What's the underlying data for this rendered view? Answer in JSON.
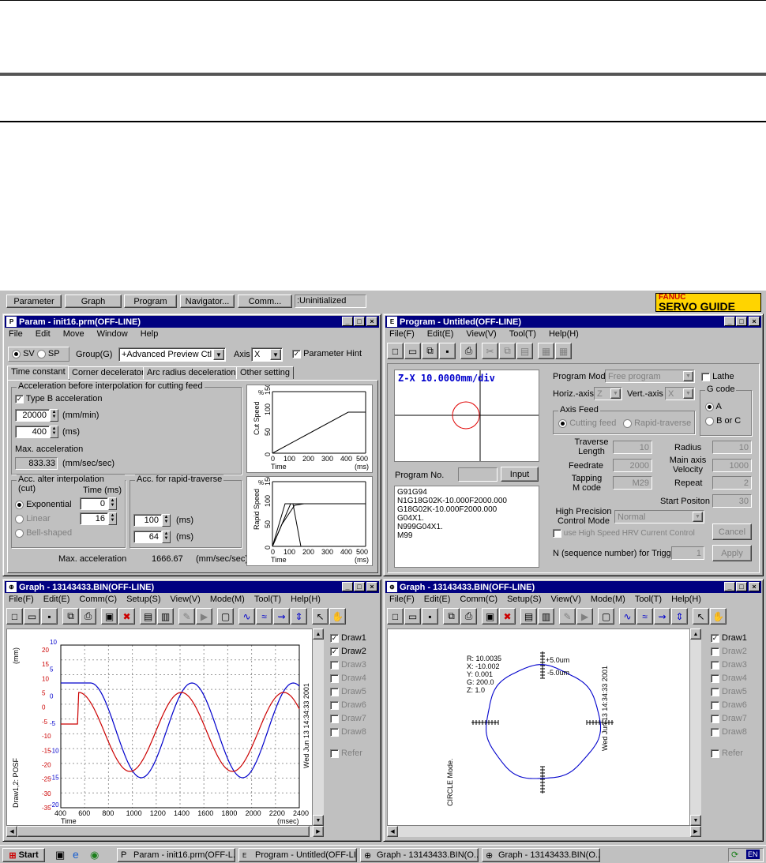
{
  "doc_rules": {
    "top_rule_note": ""
  },
  "top_bar": {
    "buttons": [
      "Parameter",
      "Graph",
      "Program",
      "Navigator...",
      "Comm..."
    ],
    "status": ":Uninitialized",
    "logo_line1": "FANUC",
    "logo_line2": "SERVO GUIDE"
  },
  "param": {
    "title": "Param - init16.prm(OFF-LINE)",
    "menu": [
      "File",
      "Edit",
      "Move",
      "Window",
      "Help"
    ],
    "sv": "SV",
    "sp": "SP",
    "group_label": "Group(G)",
    "group_value": "+Advanced Preview Ctl",
    "axis_label": "Axis",
    "axis_value": "X",
    "hint_label": "Parameter Hint",
    "tabs": [
      "Time constant",
      "Corner deceleraton",
      "Arc radius deceleration",
      "Other setting"
    ],
    "acc_group": "Acceleration before interpolation for cutting feed",
    "typeb": "Type B acceleration",
    "val1": "20000",
    "unit1": "(mm/min)",
    "val2": "400",
    "unit2": "(ms)",
    "maxacc_label": "Max. acceleration",
    "maxacc_val": "833.33",
    "maxacc_unit": "(mm/sec/sec)",
    "acc_after": "Acc. alter interpolation (cut)",
    "time_ms": "Time (ms)",
    "exp": "Exponential",
    "exp_val": "0",
    "linear": "Linear",
    "linear_val": "16",
    "bell": "Bell-shaped",
    "rapid_group": "Acc. for rapid-traverse",
    "rapid_val1": "100",
    "rapid_unit1": "(ms)",
    "rapid_val2": "64",
    "rapid_unit2": "(ms)",
    "max2_label": "Max. acceleration",
    "max2_val": "1666.67",
    "max2_unit": "(mm/sec/sec)",
    "chart1": {
      "ylabel": "Cut Speed",
      "yunit": "%",
      "yticks": [
        "0",
        "50",
        "100",
        "150"
      ],
      "xticks": [
        "0",
        "100",
        "200",
        "300",
        "400",
        "500"
      ],
      "xlabel": "Time",
      "xunit": "(ms)"
    },
    "chart2": {
      "ylabel": "Rapid Speed",
      "yunit": "%",
      "yticks": [
        "0",
        "50",
        "100",
        "150"
      ],
      "xticks": [
        "0",
        "100",
        "200",
        "300",
        "400",
        "500"
      ],
      "xlabel": "Time",
      "xunit": "(ms)"
    }
  },
  "program": {
    "title": "Program - Untitled(OFF-LINE)",
    "menu": [
      "File(F)",
      "Edit(E)",
      "View(V)",
      "Tool(T)",
      "Help(H)"
    ],
    "plot_label": "Z-X 10.0000mm/div",
    "mode_label": "Program Mode",
    "mode_value": "Free program",
    "lathe": "Lathe",
    "horiz_label": "Horiz.-axis",
    "horiz_value": "Z",
    "vert_label": "Vert.-axis",
    "vert_value": "X",
    "gcode_label": "G code",
    "gcode_a": "A",
    "gcode_bc": "B or C",
    "feed_group": "Axis Feed",
    "cutting": "Cutting feed",
    "rapid": "Rapid-traverse",
    "trav_label": "Traverse Length",
    "trav_val": "10",
    "radius_label": "Radius",
    "radius_val": "10",
    "feed_label": "Feedrate",
    "feed_val": "2000",
    "main_label": "Main axis Velocity",
    "main_val": "1000",
    "tap_label": "Tapping M code",
    "tap_val": "M29",
    "repeat_label": "Repeat",
    "repeat_val": "2",
    "start_label": "Start Positon",
    "start_val": "30",
    "progno_label": "Program No.",
    "input_btn": "Input",
    "code": [
      "G91G94",
      "N1G18G02K-10.000F2000.000",
      "G18G02K-10.000F2000.000",
      "G04X1.",
      "N999G04X1.",
      "M99"
    ],
    "hp_label": "High Precision Control Mode",
    "hp_value": "Normal",
    "cancel": "Cancel",
    "hrv": "use High Speed HRV Current Control",
    "trigger_label": "N (sequence number) for Trigger",
    "trigger_val": "1",
    "apply": "Apply"
  },
  "graph1": {
    "title": "Graph - 13143433.BIN(OFF-LINE)",
    "menu": [
      "File(F)",
      "Edit(E)",
      "Comm(C)",
      "Setup(S)",
      "View(V)",
      "Mode(M)",
      "Tool(T)",
      "Help(H)"
    ],
    "yunit": "(mm)",
    "side_label": "Draw1,2: POSF",
    "date": "Wed Jun 13 14:34:33 2001",
    "xticks": [
      "400",
      "600",
      "800",
      "1000",
      "1200",
      "1400",
      "1600",
      "1800",
      "2000",
      "2200",
      "2400"
    ],
    "xlabel": "Time",
    "xunit": "(msec)",
    "blue_ticks": [
      "10",
      "5",
      "0",
      "-5",
      "-10",
      "-15",
      "-20"
    ],
    "red_ticks": [
      "20",
      "15",
      "10",
      "5",
      "0",
      "-5",
      "-10",
      "-15",
      "-20",
      "-25",
      "-30",
      "-35"
    ],
    "draws": [
      "Draw1",
      "Draw2",
      "Draw3",
      "Draw4",
      "Draw5",
      "Draw6",
      "Draw7",
      "Draw8",
      "Refer"
    ]
  },
  "graph2": {
    "title": "Graph - 13143433.BIN(OFF-LINE)",
    "menu": [
      "File(F)",
      "Edit(E)",
      "Comm(C)",
      "Setup(S)",
      "View(V)",
      "Mode(M)",
      "Tool(T)",
      "Help(H)"
    ],
    "stats": [
      "R:  10.0035",
      "X:  -10.002",
      "Y:  0.001",
      "G:  200.0",
      "Z:  1.0"
    ],
    "plus": "+5.0um",
    "minus": "-5.0um",
    "mode": "CIRCLE Mode.",
    "date": "Wed Jun 13 14:34:33 2001",
    "draws": [
      "Draw1",
      "Draw2",
      "Draw3",
      "Draw4",
      "Draw5",
      "Draw6",
      "Draw7",
      "Draw8",
      "Refer"
    ]
  },
  "taskbar": {
    "start": "Start",
    "items": [
      "Param - init16.prm(OFF-L...",
      "Program - Untitled(OFF-LI...",
      "Graph - 13143433.BIN(O...",
      "Graph - 13143433.BIN(O..."
    ],
    "lang": "EN"
  }
}
